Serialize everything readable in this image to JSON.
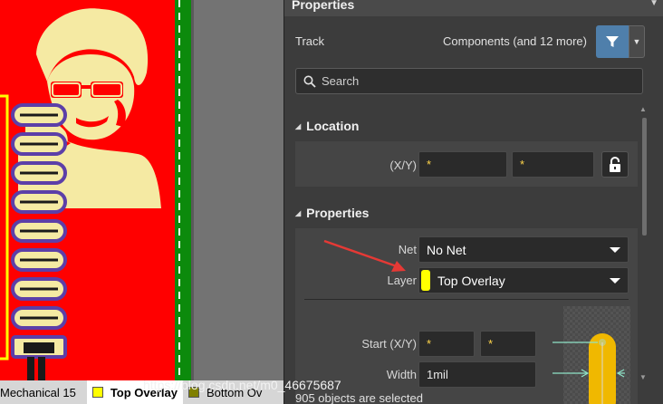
{
  "canvas": {
    "colors": {
      "top_layer": "#ff0000",
      "keepout": "#0c8a0c",
      "silk": "#f5eaa3",
      "pads": "#5c3fa8"
    }
  },
  "layer_tabs": [
    {
      "label": "Mechanical 15",
      "color": ""
    },
    {
      "label": "Top Overlay",
      "color": "#ffff00",
      "active": true
    },
    {
      "label": "Bottom Ov",
      "color": "#808000"
    }
  ],
  "panel": {
    "title": "Properties",
    "filter": {
      "object_kind": "Track",
      "summary": "Components (and 12 more)"
    },
    "search": {
      "placeholder": "Search"
    },
    "location": {
      "heading": "Location",
      "xy_label": "(X/Y)",
      "x_value": "*",
      "y_value": "*"
    },
    "properties": {
      "heading": "Properties",
      "net_label": "Net",
      "net_value": "No Net",
      "layer_label": "Layer",
      "layer_value": "Top Overlay",
      "layer_color": "#ffff00",
      "start_label": "Start (X/Y)",
      "start_x": "*",
      "start_y": "*",
      "width_label": "Width",
      "width_value": "1mil"
    },
    "status": "905 objects are selected",
    "accent": "#4f7fab",
    "arrow_color": "#e53935"
  },
  "watermark": "https://blog.csdn.net/m0_46675687"
}
